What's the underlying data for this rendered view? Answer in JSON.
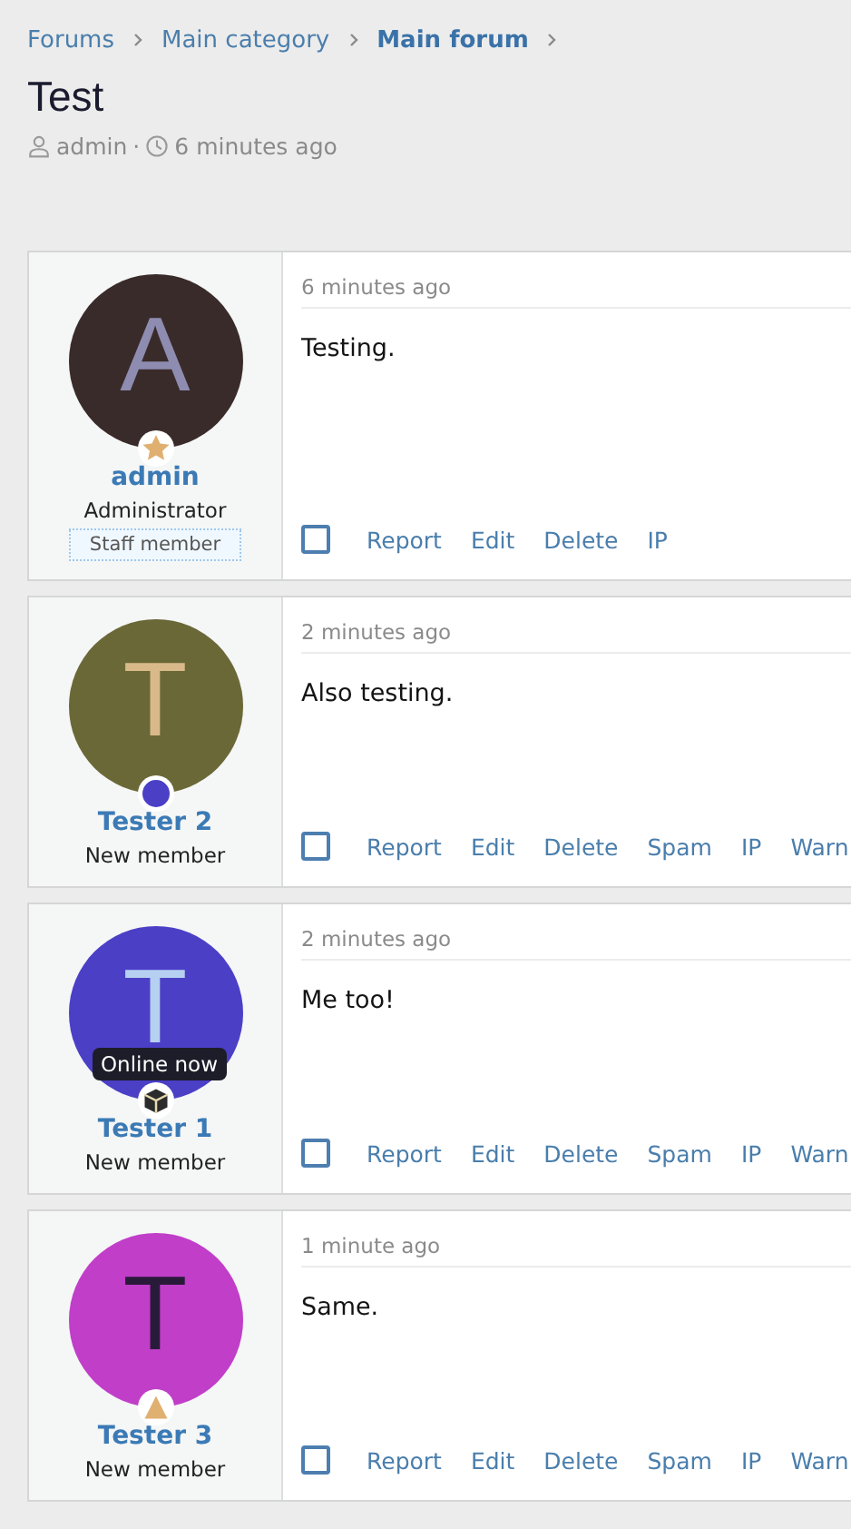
{
  "breadcrumbs": [
    {
      "label": "Forums",
      "current": false
    },
    {
      "label": "Main category",
      "current": false
    },
    {
      "label": "Main forum",
      "current": true
    }
  ],
  "thread": {
    "title": "Test",
    "author": "admin",
    "separator": "·",
    "time": "6 minutes ago"
  },
  "posts": [
    {
      "user": {
        "name": "admin",
        "title": "Administrator",
        "banner": "Staff member",
        "avatar": {
          "color": "#3a2b2b",
          "letter": {
            "text": "A",
            "color": "#8e8cb0"
          }
        },
        "badge": {
          "kind": "star"
        }
      },
      "time": "6 minutes ago",
      "message": "Testing.",
      "checked": false,
      "actions": [
        "Report",
        "Edit",
        "Delete",
        "IP"
      ]
    },
    {
      "user": {
        "name": "Tester 2",
        "title": "New member",
        "avatar": {
          "color": "#6b6838",
          "letter": {
            "text": "T",
            "color": "#d9b98a"
          }
        },
        "badge": {
          "kind": "dot"
        }
      },
      "time": "2 minutes ago",
      "message": "Also testing.",
      "checked": false,
      "actions": [
        "Report",
        "Edit",
        "Delete",
        "Spam",
        "IP",
        "Warn"
      ]
    },
    {
      "user": {
        "name": "Tester 1",
        "title": "New member",
        "avatar": {
          "color": "#4b3fc6",
          "letter": {
            "text": "T",
            "color": "#b5d0f0"
          }
        },
        "badge": {
          "kind": "box"
        },
        "tooltip": "Online now"
      },
      "time": "2 minutes ago",
      "message": "Me too!",
      "checked": false,
      "actions": [
        "Report",
        "Edit",
        "Delete",
        "Spam",
        "IP",
        "Warn"
      ]
    },
    {
      "user": {
        "name": "Tester 3",
        "title": "New member",
        "avatar": {
          "color": "#c03ec8",
          "letter": {
            "text": "T",
            "color": "#2a1a3a"
          }
        },
        "badge": {
          "kind": "triangle"
        }
      },
      "time": "1 minute ago",
      "message": "Same.",
      "checked": false,
      "actions": [
        "Report",
        "Edit",
        "Delete",
        "Spam",
        "IP",
        "Warn"
      ]
    }
  ]
}
